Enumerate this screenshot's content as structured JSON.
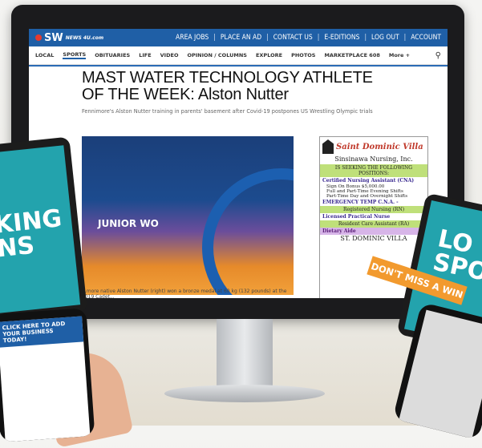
{
  "site": {
    "logo_text": "SW",
    "logo_sub": "NEWS 4U.com",
    "top_links": [
      "AREA JOBS",
      "PLACE AN AD",
      "CONTACT US",
      "E-EDITIONS",
      "LOG OUT",
      "ACCOUNT"
    ]
  },
  "nav": {
    "items": [
      "LOCAL",
      "SPORTS",
      "OBITUARIES",
      "LIFE",
      "VIDEO",
      "OPINION / COLUMNS",
      "EXPLORE",
      "PHOTOS",
      "MARKETPLACE 608",
      "More +"
    ]
  },
  "article": {
    "headline": "MAST WATER TECHNOLOGY ATHLETE OF THE WEEK: Alston Nutter",
    "subhead": "Fennimore's Alston Nutter training in parents' basement after Covid-19 postpones US Wrestling Olympic trials",
    "photo_banner": "JUNIOR WO",
    "caption": "...more native Alston Nutter (right) won a bronze medal at 60 kg (132 pounds) at the 2019 Cadet..."
  },
  "ad": {
    "title": "Saint Dominic Villa",
    "company": "Sinsinawa Nursing, Inc.",
    "seeking": "IS SEEKING THE FOLLOWING POSITIONS:",
    "cna": "Certified Nursing Assistant (CNA)",
    "bonus": "Sign On Bonus $5,000.00",
    "shifts1": "Full and Part-Time Evening Shifts",
    "shifts2": "Part-Time Day and Overnight Shifts",
    "emergency": "EMERGENCY TEMP C.N.A. -",
    "rn": "Registered Nursing (RN)",
    "lpn": "Licensed Practical Nurse",
    "ra": "Resident Care Assistant (RA)",
    "dietary": "Dietary Aide",
    "footer": "ST. DOMINIC VILLA"
  },
  "promo": {
    "left_text": "KING NS",
    "right_text": "LO SPO",
    "cta": "DON'T MISS A WIN",
    "phone_cta": "CLICK HERE TO ADD YOUR BUSINESS TODAY!"
  }
}
